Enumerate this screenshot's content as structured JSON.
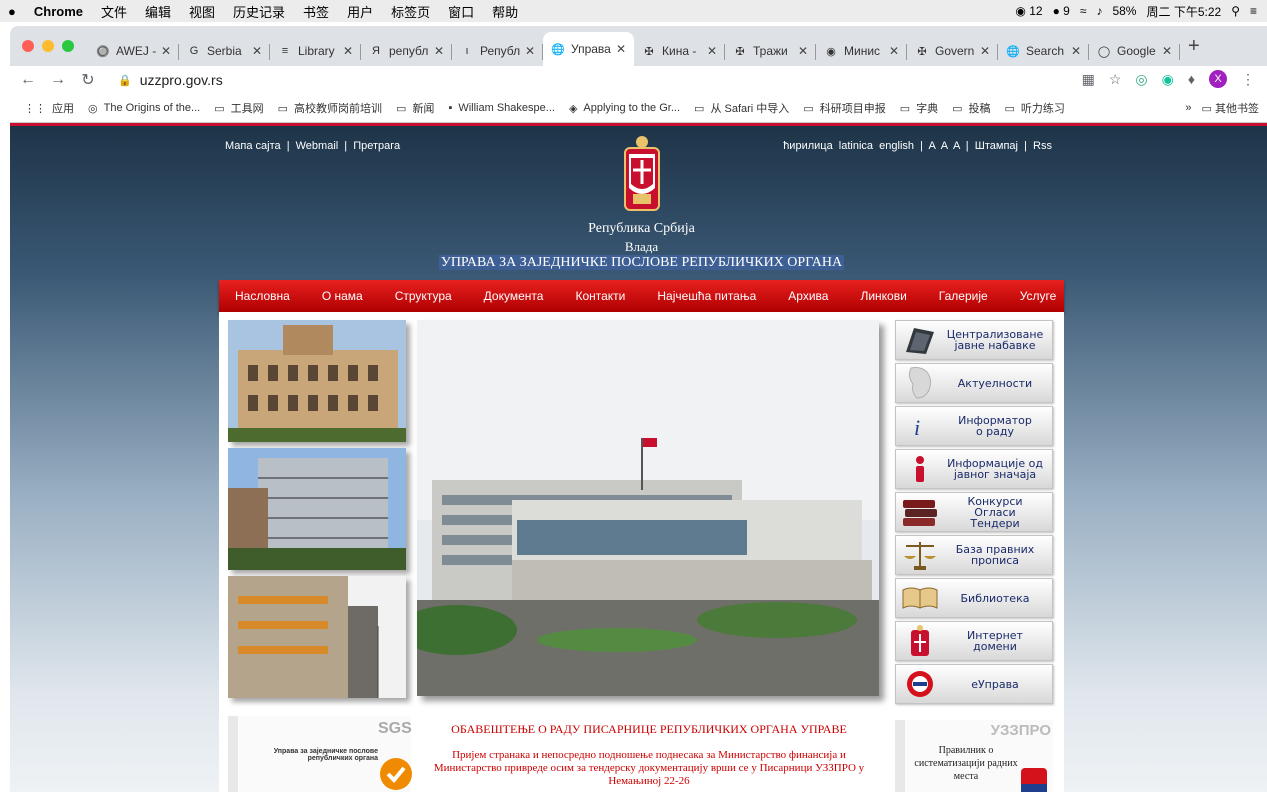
{
  "menubar": {
    "apple": "",
    "app": "Chrome",
    "items": [
      "文件",
      "编辑",
      "视图",
      "历史记录",
      "书签",
      "用户",
      "标签页",
      "窗口",
      "帮助"
    ],
    "status": {
      "wechat": "12",
      "notif": "9",
      "battery": "58%",
      "clock": "周二 下午5:22"
    }
  },
  "tabs": [
    {
      "icon": "🔘",
      "title": "AWEJ -"
    },
    {
      "icon": "G",
      "title": "Serbia"
    },
    {
      "icon": "≡",
      "title": "Library"
    },
    {
      "icon": "Я",
      "title": "републ"
    },
    {
      "icon": "ı",
      "title": "Републ"
    },
    {
      "icon": "🌐",
      "title": "Управа",
      "active": true
    },
    {
      "icon": "✠",
      "title": "Кина -"
    },
    {
      "icon": "✠",
      "title": "Тражи"
    },
    {
      "icon": "◉",
      "title": "Минис"
    },
    {
      "icon": "✠",
      "title": "Govern"
    },
    {
      "icon": "🌐",
      "title": "Search"
    },
    {
      "icon": "◯",
      "title": "Google"
    }
  ],
  "omnibar": {
    "url": "uzzpro.gov.rs"
  },
  "bookmarks": [
    {
      "icon": "⋮⋮",
      "label": "应用"
    },
    {
      "icon": "◎",
      "label": "The Origins of the..."
    },
    {
      "icon": "▭",
      "label": "工具网"
    },
    {
      "icon": "▭",
      "label": "高校教师岗前培训"
    },
    {
      "icon": "▭",
      "label": "新闻"
    },
    {
      "icon": "▪",
      "label": "William Shakespe..."
    },
    {
      "icon": "◈",
      "label": "Applying to the Gr..."
    },
    {
      "icon": "▭",
      "label": "从 Safari 中导入"
    },
    {
      "icon": "▭",
      "label": "科研项目申报"
    },
    {
      "icon": "▭",
      "label": "字典"
    },
    {
      "icon": "▭",
      "label": "投稿"
    },
    {
      "icon": "▭",
      "label": "听力练习"
    }
  ],
  "bookmarks_more": "»",
  "bookmarks_other": "其他书签",
  "site": {
    "toplinks": [
      "Мапа сајта",
      "|",
      "Webmail",
      "|",
      "Претрага"
    ],
    "rightlinks": "ћирилица  latinica  english  |  A  A  A  |  Штампај  |  Rss",
    "republic": "Република Србија",
    "government": "Влада",
    "agency": "УПРАВА ЗА ЗАЈЕДНИЧКЕ ПОСЛОВЕ РЕПУБЛИЧКИХ ОРГАНА",
    "nav": [
      "Насловна",
      "О нама",
      "Структура",
      "Документа",
      "Контакти",
      "Најчешћа питања",
      "Архива",
      "Линкови",
      "Галерије",
      "Услуге"
    ],
    "side": [
      {
        "icon": "tablet-icon",
        "label": "Централизоване\nјавне набавке"
      },
      {
        "icon": "map-icon",
        "label": "Актуелности"
      },
      {
        "icon": "info-icon",
        "label": "Информатор\nо раду"
      },
      {
        "icon": "info-red-icon",
        "label": "Информације од\nјавног значаја"
      },
      {
        "icon": "books-icon",
        "label": "Конкурси\nОгласи\nТендери"
      },
      {
        "icon": "scales-icon",
        "label": "База правних\nпрописа"
      },
      {
        "icon": "book-icon",
        "label": "Библиотека"
      },
      {
        "icon": "crest-icon",
        "label": "Интернет\nдомени"
      },
      {
        "icon": "eupr-icon",
        "label": "еУправа"
      }
    ],
    "notice_title": "ОБАВЕШТЕЊЕ О РАДУ ПИСАРНИЦЕ РЕПУБЛИЧКИХ ОРГАНА УПРАВЕ",
    "notice_body": "Пријем странака и непосредно подношење поднесака за Министарство финансија и Министарство привреде осим за тендерску документацију врши се у Писарници УЗЗПРО у Немањиној 22-26",
    "cert_org": "Управа за заједничке послове републичких органа",
    "cert_sgs": "SGS",
    "rule_text": "Правилник о систематизацији радних места",
    "rule_logo": "УЗЗПРО"
  }
}
